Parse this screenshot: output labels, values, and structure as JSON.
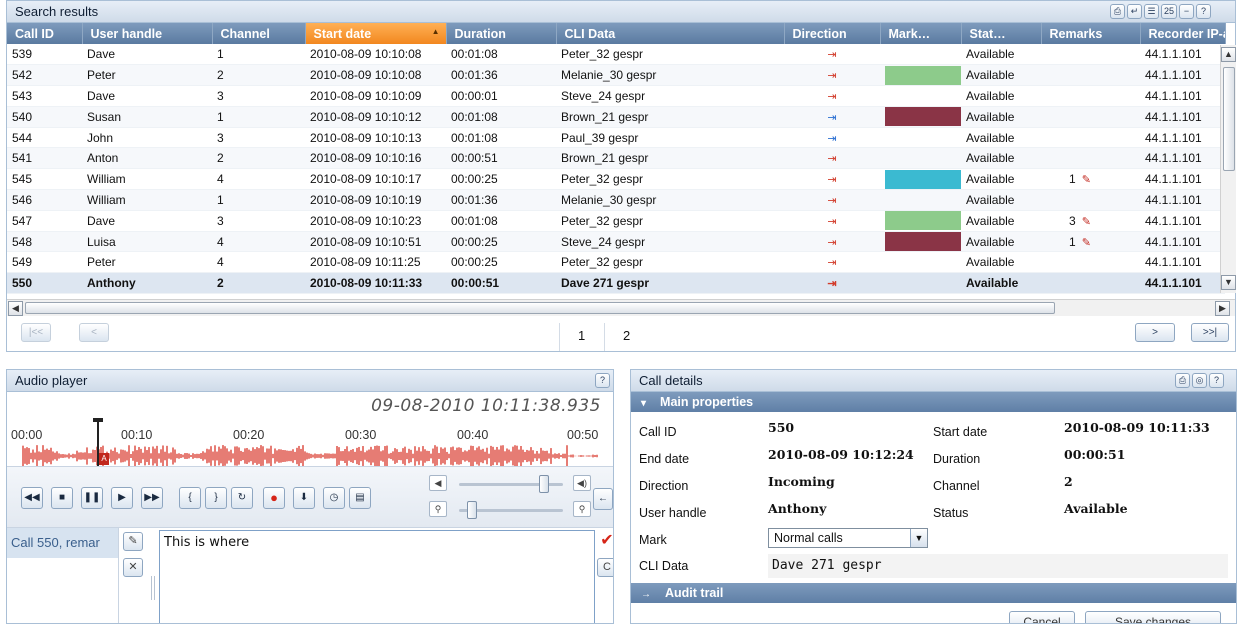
{
  "search": {
    "title": "Search results",
    "tools": [
      "⎙",
      "↵",
      "☰",
      "25",
      "−",
      "?"
    ],
    "columns": [
      "Call ID",
      "User handle",
      "Channel",
      "Start date",
      "Duration",
      "CLI Data",
      "Direction",
      "Mark…",
      "Stat…",
      "Remarks",
      "Recorder IP-a"
    ],
    "rows": [
      {
        "id": "539",
        "user": "Dave",
        "channel": "1",
        "start": "2010-08-09 10:10:08",
        "duration": "00:01:08",
        "cli": "Peter_32 gespr",
        "dir": "in",
        "mark": "",
        "status": "Available",
        "remarks": "",
        "ip": "44.1.1.101"
      },
      {
        "id": "542",
        "user": "Peter",
        "channel": "2",
        "start": "2010-08-09 10:10:08",
        "duration": "00:01:36",
        "cli": "Melanie_30 gespr",
        "dir": "in",
        "mark": "#8dcb8b",
        "status": "Available",
        "remarks": "",
        "ip": "44.1.1.101"
      },
      {
        "id": "543",
        "user": "Dave",
        "channel": "3",
        "start": "2010-08-09 10:10:09",
        "duration": "00:00:01",
        "cli": "Steve_24 gespr",
        "dir": "in",
        "mark": "",
        "status": "Available",
        "remarks": "",
        "ip": "44.1.1.101"
      },
      {
        "id": "540",
        "user": "Susan",
        "channel": "1",
        "start": "2010-08-09 10:10:12",
        "duration": "00:01:08",
        "cli": "Brown_21 gespr",
        "dir": "out",
        "mark": "#8a3446",
        "status": "Available",
        "remarks": "",
        "ip": "44.1.1.101"
      },
      {
        "id": "544",
        "user": "John",
        "channel": "3",
        "start": "2010-08-09 10:10:13",
        "duration": "00:01:08",
        "cli": "Paul_39 gespr",
        "dir": "out",
        "mark": "",
        "status": "Available",
        "remarks": "",
        "ip": "44.1.1.101"
      },
      {
        "id": "541",
        "user": "Anton",
        "channel": "2",
        "start": "2010-08-09 10:10:16",
        "duration": "00:00:51",
        "cli": "Brown_21 gespr",
        "dir": "in",
        "mark": "",
        "status": "Available",
        "remarks": "",
        "ip": "44.1.1.101"
      },
      {
        "id": "545",
        "user": "William",
        "channel": "4",
        "start": "2010-08-09 10:10:17",
        "duration": "00:00:25",
        "cli": "Peter_32 gespr",
        "dir": "in",
        "mark": "#3bbad1",
        "status": "Available",
        "remarks": "1",
        "ip": "44.1.1.101"
      },
      {
        "id": "546",
        "user": "William",
        "channel": "1",
        "start": "2010-08-09 10:10:19",
        "duration": "00:01:36",
        "cli": "Melanie_30 gespr",
        "dir": "in",
        "mark": "",
        "status": "Available",
        "remarks": "",
        "ip": "44.1.1.101"
      },
      {
        "id": "547",
        "user": "Dave",
        "channel": "3",
        "start": "2010-08-09 10:10:23",
        "duration": "00:01:08",
        "cli": "Peter_32 gespr",
        "dir": "in",
        "mark": "#8dcb8b",
        "status": "Available",
        "remarks": "3",
        "ip": "44.1.1.101"
      },
      {
        "id": "548",
        "user": "Luisa",
        "channel": "4",
        "start": "2010-08-09 10:10:51",
        "duration": "00:00:25",
        "cli": "Steve_24 gespr",
        "dir": "in",
        "mark": "#8a3446",
        "status": "Available",
        "remarks": "1",
        "ip": "44.1.1.101"
      },
      {
        "id": "549",
        "user": "Peter",
        "channel": "4",
        "start": "2010-08-09 10:11:25",
        "duration": "00:00:25",
        "cli": "Peter_32 gespr",
        "dir": "in",
        "mark": "",
        "status": "Available",
        "remarks": "",
        "ip": "44.1.1.101"
      },
      {
        "id": "550",
        "user": "Anthony",
        "channel": "2",
        "start": "2010-08-09 10:11:33",
        "duration": "00:00:51",
        "cli": "Dave 271 gespr",
        "dir": "in",
        "mark": "",
        "status": "Available",
        "remarks": "",
        "ip": "44.1.1.101",
        "selected": true
      }
    ],
    "pager": {
      "first": "|<<",
      "prev": "<",
      "pages": [
        "1",
        "2"
      ],
      "next": ">",
      "last": ">>|"
    }
  },
  "audio": {
    "title": "Audio player",
    "help": "?",
    "datetime": "09-08-2010 10:11:38.935",
    "timeline_labels": [
      "00:00",
      "00:10",
      "00:20",
      "00:30",
      "00:40",
      "00:50"
    ],
    "marker_label": "A",
    "remark_item": "Call 550, remar",
    "remark_text": "This is where",
    "confirm": "✔",
    "clear": "C"
  },
  "details": {
    "title": "Call details",
    "tools": [
      "⎙",
      "◎",
      "?"
    ],
    "main_section": "Main properties",
    "audit_section": "Audit trail",
    "labels": {
      "call_id": "Call ID",
      "end_date": "End date",
      "direction": "Direction",
      "user_handle": "User handle",
      "mark": "Mark",
      "cli": "CLI Data",
      "start_date": "Start date",
      "duration": "Duration",
      "channel": "Channel",
      "status": "Status"
    },
    "values": {
      "call_id": "550",
      "end_date": "2010-08-09 10:12:24",
      "direction": "Incoming",
      "user_handle": "Anthony",
      "start_date": "2010-08-09 10:11:33",
      "duration": "00:00:51",
      "channel": "2",
      "status": "Available",
      "mark": "Normal calls",
      "cli": "Dave 271 gespr"
    },
    "buttons": {
      "cancel": "Cancel",
      "save": "Save changes"
    }
  },
  "colors": {
    "header": "#5a7aa0",
    "sorted_header": "#f2871f",
    "waveform": "#d62518"
  }
}
